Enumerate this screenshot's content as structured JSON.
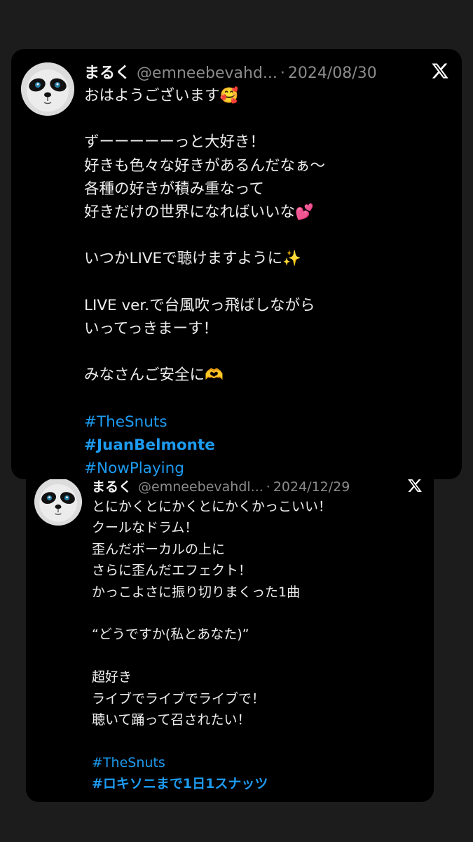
{
  "accent_color": "#1d9bf0",
  "posts": [
    {
      "name": "まるく",
      "handle": "@emneebevahd...",
      "separator": "·",
      "date": "2024/08/30",
      "lines": [
        "おはようございます🥰",
        "",
        "ずーーーーーっと大好き！",
        "好きも色々な好きがあるんだなぁ〜",
        "各種の好きが積み重なって",
        "好きだけの世界になればいいな💕",
        "",
        "いつかLIVEで聴けますように✨",
        "",
        "LIVE ver.で台風吹っ飛ばしながら",
        "いってっきまーす！",
        "",
        "みなさんご安全に🫶",
        ""
      ],
      "hashtags": [
        "#TheSnuts",
        "#JuanBelmonte",
        "#NowPlaying"
      ]
    },
    {
      "name": "まるく",
      "handle": "@emneebevahdl...",
      "separator": "·",
      "date": "2024/12/29",
      "lines": [
        "とにかくとにかくとにかくかっこいい！",
        "クールなドラム！",
        "歪んだボーカルの上に",
        "さらに歪んだエフェクト！",
        "かっこよさに振り切りまくった1曲",
        "",
        "“どうですか(私とあなた)”",
        "",
        "超好き",
        "ライブでライブでライブで！",
        "聴いて踊って召されたい！",
        ""
      ],
      "hashtags": [
        "#TheSnuts",
        "#ロキソニまで1日1スナッツ"
      ]
    }
  ]
}
